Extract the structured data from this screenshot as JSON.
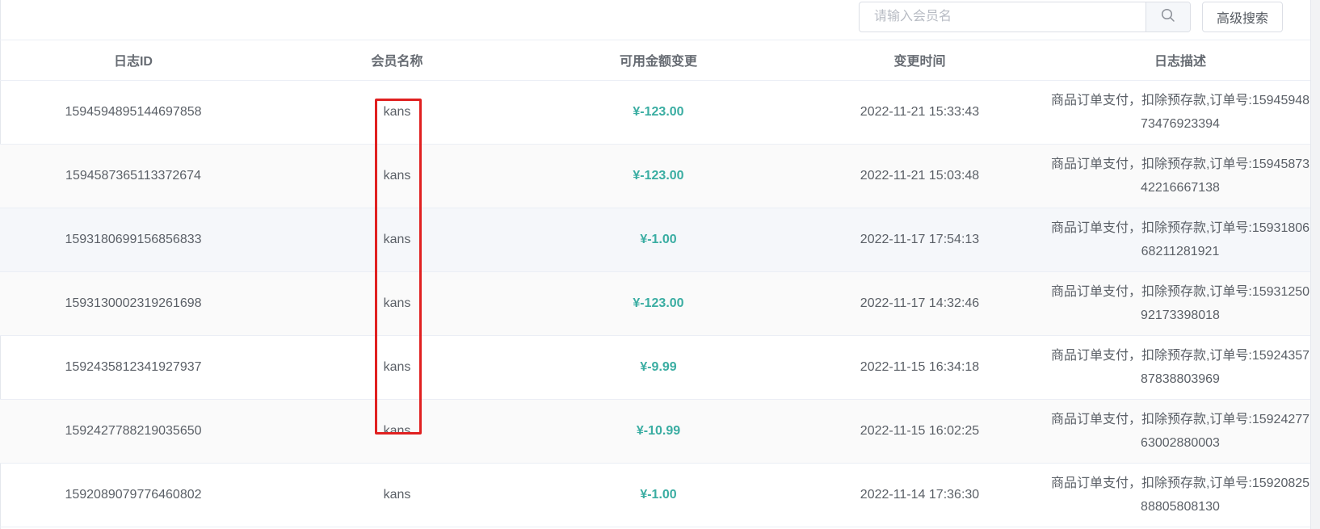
{
  "search": {
    "placeholder": "请输入会员名",
    "value": "",
    "icon": "search-icon"
  },
  "advanced_search_label": "高级搜索",
  "table": {
    "columns": [
      "日志ID",
      "会员名称",
      "可用金额变更",
      "变更时间",
      "日志描述"
    ],
    "rows": [
      {
        "id": "1594594895144697858",
        "member": "kans",
        "amount": "¥-123.00",
        "time": "2022-11-21 15:33:43",
        "desc": "商品订单支付，扣除预存款,订单号:1594594873476923394"
      },
      {
        "id": "1594587365113372674",
        "member": "kans",
        "amount": "¥-123.00",
        "time": "2022-11-21 15:03:48",
        "desc": "商品订单支付，扣除预存款,订单号:1594587342216667138"
      },
      {
        "id": "1593180699156856833",
        "member": "kans",
        "amount": "¥-1.00",
        "time": "2022-11-17 17:54:13",
        "desc": "商品订单支付，扣除预存款,订单号:1593180668211281921"
      },
      {
        "id": "1593130002319261698",
        "member": "kans",
        "amount": "¥-123.00",
        "time": "2022-11-17 14:32:46",
        "desc": "商品订单支付，扣除预存款,订单号:1593125092173398018"
      },
      {
        "id": "1592435812341927937",
        "member": "kans",
        "amount": "¥-9.99",
        "time": "2022-11-15 16:34:18",
        "desc": "商品订单支付，扣除预存款,订单号:1592435787838803969"
      },
      {
        "id": "1592427788219035650",
        "member": "kans",
        "amount": "¥-10.99",
        "time": "2022-11-15 16:02:25",
        "desc": "商品订单支付，扣除预存款,订单号:1592427763002880003"
      },
      {
        "id": "1592089079776460802",
        "member": "kans",
        "amount": "¥-1.00",
        "time": "2022-11-14 17:36:30",
        "desc": "商品订单支付，扣除预存款,订单号:1592082588805808130"
      }
    ]
  },
  "colors": {
    "amount_text": "#3aada2",
    "highlight_border": "#e02020",
    "border": "#ebeef5"
  }
}
